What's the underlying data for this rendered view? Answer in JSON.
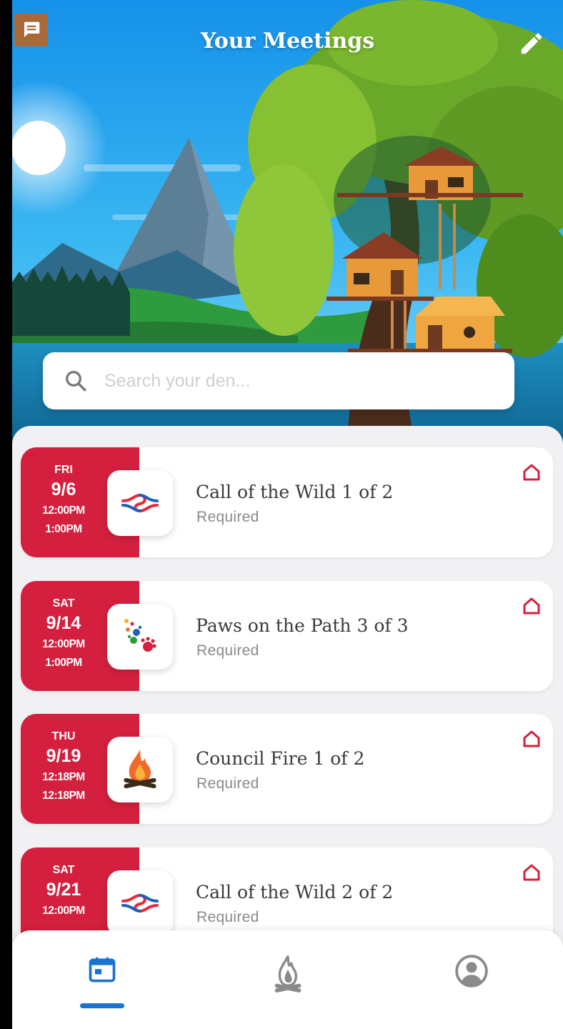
{
  "header": {
    "title": "Your Meetings",
    "edit_icon": "pencil-icon",
    "chat_icon": "chat-bubble-icon"
  },
  "search": {
    "placeholder": "Search your den...",
    "value": "",
    "icon": "search-icon"
  },
  "meetings": [
    {
      "dow": "FRI",
      "date": "9/6",
      "start": "12:00PM",
      "end": "1:00PM",
      "title": "Call of the Wild 1 of 2",
      "status": "Required",
      "icon": "knot-icon"
    },
    {
      "dow": "SAT",
      "date": "9/14",
      "start": "12:00PM",
      "end": "1:00PM",
      "title": "Paws on the Path 3 of 3",
      "status": "Required",
      "icon": "paw-prints-icon"
    },
    {
      "dow": "THU",
      "date": "9/19",
      "start": "12:18PM",
      "end": "12:18PM",
      "title": "Council Fire 1 of 2",
      "status": "Required",
      "icon": "campfire-icon"
    },
    {
      "dow": "SAT",
      "date": "9/21",
      "start": "12:00PM",
      "end": "",
      "title": "Call of the Wild 2 of 2",
      "status": "Required",
      "icon": "knot-icon"
    }
  ],
  "nav": {
    "items": [
      {
        "name": "meetings",
        "icon": "calendar-icon",
        "active": true
      },
      {
        "name": "adventures",
        "icon": "campfire-icon",
        "active": false
      },
      {
        "name": "profile",
        "icon": "profile-icon",
        "active": false
      }
    ]
  },
  "colors": {
    "accent_red": "#d4203e",
    "nav_active": "#1a73d1",
    "sky_top": "#1c9ff0",
    "background": "#f1f1f3"
  }
}
